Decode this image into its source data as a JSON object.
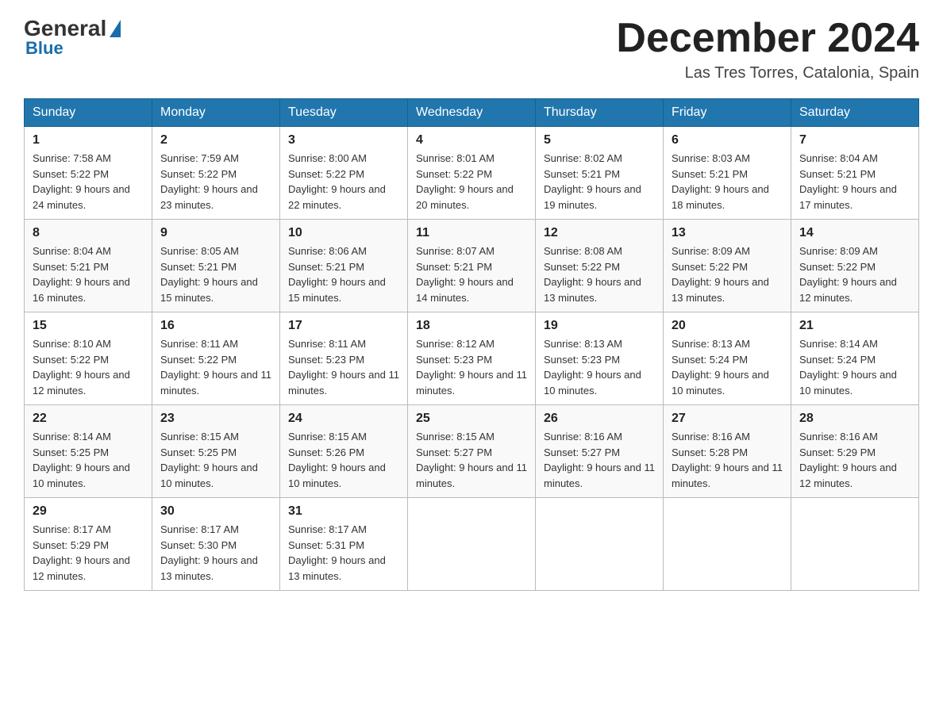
{
  "logo": {
    "general": "General",
    "blue": "Blue"
  },
  "title": "December 2024",
  "location": "Las Tres Torres, Catalonia, Spain",
  "days_of_week": [
    "Sunday",
    "Monday",
    "Tuesday",
    "Wednesday",
    "Thursday",
    "Friday",
    "Saturday"
  ],
  "weeks": [
    [
      {
        "day": "1",
        "sunrise": "7:58 AM",
        "sunset": "5:22 PM",
        "daylight": "9 hours and 24 minutes."
      },
      {
        "day": "2",
        "sunrise": "7:59 AM",
        "sunset": "5:22 PM",
        "daylight": "9 hours and 23 minutes."
      },
      {
        "day": "3",
        "sunrise": "8:00 AM",
        "sunset": "5:22 PM",
        "daylight": "9 hours and 22 minutes."
      },
      {
        "day": "4",
        "sunrise": "8:01 AM",
        "sunset": "5:22 PM",
        "daylight": "9 hours and 20 minutes."
      },
      {
        "day": "5",
        "sunrise": "8:02 AM",
        "sunset": "5:21 PM",
        "daylight": "9 hours and 19 minutes."
      },
      {
        "day": "6",
        "sunrise": "8:03 AM",
        "sunset": "5:21 PM",
        "daylight": "9 hours and 18 minutes."
      },
      {
        "day": "7",
        "sunrise": "8:04 AM",
        "sunset": "5:21 PM",
        "daylight": "9 hours and 17 minutes."
      }
    ],
    [
      {
        "day": "8",
        "sunrise": "8:04 AM",
        "sunset": "5:21 PM",
        "daylight": "9 hours and 16 minutes."
      },
      {
        "day": "9",
        "sunrise": "8:05 AM",
        "sunset": "5:21 PM",
        "daylight": "9 hours and 15 minutes."
      },
      {
        "day": "10",
        "sunrise": "8:06 AM",
        "sunset": "5:21 PM",
        "daylight": "9 hours and 15 minutes."
      },
      {
        "day": "11",
        "sunrise": "8:07 AM",
        "sunset": "5:21 PM",
        "daylight": "9 hours and 14 minutes."
      },
      {
        "day": "12",
        "sunrise": "8:08 AM",
        "sunset": "5:22 PM",
        "daylight": "9 hours and 13 minutes."
      },
      {
        "day": "13",
        "sunrise": "8:09 AM",
        "sunset": "5:22 PM",
        "daylight": "9 hours and 13 minutes."
      },
      {
        "day": "14",
        "sunrise": "8:09 AM",
        "sunset": "5:22 PM",
        "daylight": "9 hours and 12 minutes."
      }
    ],
    [
      {
        "day": "15",
        "sunrise": "8:10 AM",
        "sunset": "5:22 PM",
        "daylight": "9 hours and 12 minutes."
      },
      {
        "day": "16",
        "sunrise": "8:11 AM",
        "sunset": "5:22 PM",
        "daylight": "9 hours and 11 minutes."
      },
      {
        "day": "17",
        "sunrise": "8:11 AM",
        "sunset": "5:23 PM",
        "daylight": "9 hours and 11 minutes."
      },
      {
        "day": "18",
        "sunrise": "8:12 AM",
        "sunset": "5:23 PM",
        "daylight": "9 hours and 11 minutes."
      },
      {
        "day": "19",
        "sunrise": "8:13 AM",
        "sunset": "5:23 PM",
        "daylight": "9 hours and 10 minutes."
      },
      {
        "day": "20",
        "sunrise": "8:13 AM",
        "sunset": "5:24 PM",
        "daylight": "9 hours and 10 minutes."
      },
      {
        "day": "21",
        "sunrise": "8:14 AM",
        "sunset": "5:24 PM",
        "daylight": "9 hours and 10 minutes."
      }
    ],
    [
      {
        "day": "22",
        "sunrise": "8:14 AM",
        "sunset": "5:25 PM",
        "daylight": "9 hours and 10 minutes."
      },
      {
        "day": "23",
        "sunrise": "8:15 AM",
        "sunset": "5:25 PM",
        "daylight": "9 hours and 10 minutes."
      },
      {
        "day": "24",
        "sunrise": "8:15 AM",
        "sunset": "5:26 PM",
        "daylight": "9 hours and 10 minutes."
      },
      {
        "day": "25",
        "sunrise": "8:15 AM",
        "sunset": "5:27 PM",
        "daylight": "9 hours and 11 minutes."
      },
      {
        "day": "26",
        "sunrise": "8:16 AM",
        "sunset": "5:27 PM",
        "daylight": "9 hours and 11 minutes."
      },
      {
        "day": "27",
        "sunrise": "8:16 AM",
        "sunset": "5:28 PM",
        "daylight": "9 hours and 11 minutes."
      },
      {
        "day": "28",
        "sunrise": "8:16 AM",
        "sunset": "5:29 PM",
        "daylight": "9 hours and 12 minutes."
      }
    ],
    [
      {
        "day": "29",
        "sunrise": "8:17 AM",
        "sunset": "5:29 PM",
        "daylight": "9 hours and 12 minutes."
      },
      {
        "day": "30",
        "sunrise": "8:17 AM",
        "sunset": "5:30 PM",
        "daylight": "9 hours and 13 minutes."
      },
      {
        "day": "31",
        "sunrise": "8:17 AM",
        "sunset": "5:31 PM",
        "daylight": "9 hours and 13 minutes."
      },
      null,
      null,
      null,
      null
    ]
  ]
}
